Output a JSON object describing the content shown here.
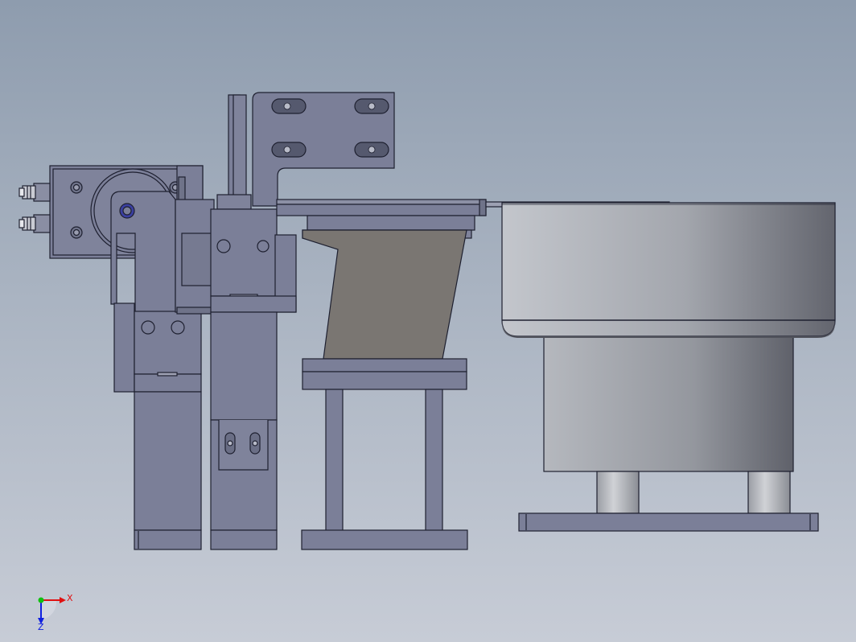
{
  "viewport": {
    "background_top": "#8e9cae",
    "background_bottom": "#c7ccd6"
  },
  "colors": {
    "part_fill": "#7b7f98",
    "part_fill_light": "#8b8fa6",
    "part_edge": "#1e2030",
    "trapezoid_fill": "#7a7672",
    "bowl_light": "#b9bcc2",
    "bowl_dark": "#6c6e77",
    "axis_x": "#e01010",
    "axis_y": "#10c010",
    "axis_z": "#1020e0"
  },
  "triad": {
    "x_label": "X",
    "z_label": "Z"
  },
  "icons": [
    "triad-icon"
  ]
}
